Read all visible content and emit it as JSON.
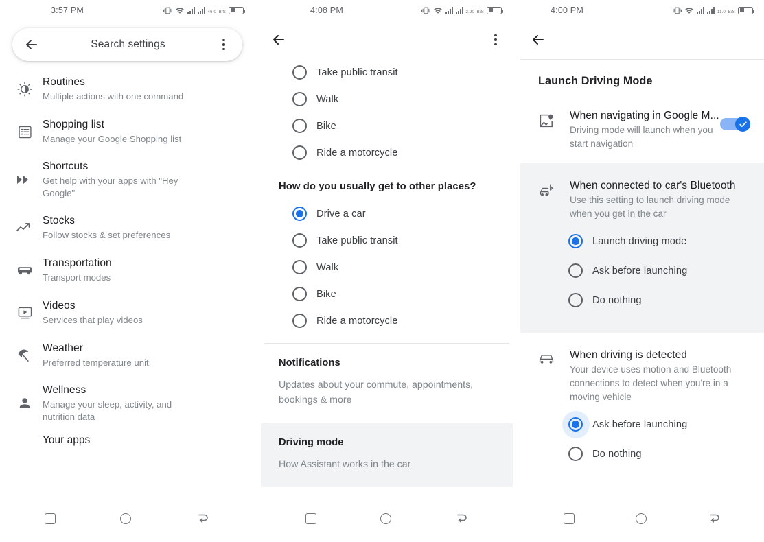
{
  "panels": {
    "left": {
      "status": {
        "time": "3:57 PM",
        "net_speed": "46.0",
        "net_unit": "B/S"
      },
      "search": {
        "placeholder": "Search settings",
        "back_icon": "arrow-back-icon",
        "more_icon": "more-vert-icon"
      },
      "items": [
        {
          "icon": "routines-icon",
          "title": "Routines",
          "subtitle": "Multiple actions with one command"
        },
        {
          "icon": "shopping-list-icon",
          "title": "Shopping list",
          "subtitle": "Manage your Google Shopping list"
        },
        {
          "icon": "shortcuts-icon",
          "title": "Shortcuts",
          "subtitle": "Get help with your apps with \"Hey Google\""
        },
        {
          "icon": "stocks-icon",
          "title": "Stocks",
          "subtitle": "Follow stocks & set preferences"
        },
        {
          "icon": "transportation-icon",
          "title": "Transportation",
          "subtitle": "Transport modes"
        },
        {
          "icon": "videos-icon",
          "title": "Videos",
          "subtitle": "Services that play videos"
        },
        {
          "icon": "weather-icon",
          "title": "Weather",
          "subtitle": "Preferred temperature unit"
        },
        {
          "icon": "wellness-icon",
          "title": "Wellness",
          "subtitle": "Manage your sleep, activity, and nutrition data"
        }
      ],
      "your_apps": "Your apps"
    },
    "middle": {
      "status": {
        "time": "4:08 PM",
        "net_speed": "2.90",
        "net_unit": "B/S"
      },
      "appbar": {
        "back_icon": "arrow-back-icon",
        "more_icon": "more-vert-icon"
      },
      "top_options": [
        {
          "label": "Take public transit",
          "selected": false
        },
        {
          "label": "Walk",
          "selected": false
        },
        {
          "label": "Bike",
          "selected": false
        },
        {
          "label": "Ride a motorcycle",
          "selected": false
        }
      ],
      "question": "How do you usually get to other places?",
      "other_options": [
        {
          "label": "Drive a car",
          "selected": true
        },
        {
          "label": "Take public transit",
          "selected": false
        },
        {
          "label": "Walk",
          "selected": false
        },
        {
          "label": "Bike",
          "selected": false
        },
        {
          "label": "Ride a motorcycle",
          "selected": false
        }
      ],
      "notifications": {
        "title": "Notifications",
        "subtitle": "Updates about your commute, appointments, bookings & more"
      },
      "driving_mode": {
        "title": "Driving mode",
        "subtitle": "How Assistant works in the car"
      }
    },
    "right": {
      "status": {
        "time": "4:00 PM",
        "net_speed": "11.0",
        "net_unit": "B/S"
      },
      "appbar": {
        "back_icon": "arrow-back-icon"
      },
      "title": "Launch Driving Mode",
      "items": [
        {
          "icon": "map-pin-icon",
          "head": "When navigating in Google M...",
          "sub": "Driving mode will launch when you start navigation",
          "toggle": {
            "name": "navigation-toggle",
            "on": true
          },
          "options": []
        },
        {
          "icon": "car-bluetooth-icon",
          "head": "When connected to car's Bluetooth",
          "sub": "Use this setting to launch driving mode when you get in the car",
          "toggle": null,
          "options": [
            {
              "label": "Launch driving mode",
              "selected": true
            },
            {
              "label": "Ask before launching",
              "selected": false
            },
            {
              "label": "Do nothing",
              "selected": false
            }
          ]
        },
        {
          "icon": "car-icon",
          "head": "When driving is detected",
          "sub": "Your device uses motion and Bluetooth connections to detect when you're in a moving vehicle",
          "toggle": null,
          "options": [
            {
              "label": "Ask before launching",
              "selected": true,
              "halo": true
            },
            {
              "label": "Do nothing",
              "selected": false
            }
          ]
        }
      ]
    }
  },
  "navbar": {
    "recents": "square-nav-icon",
    "home": "circle-nav-icon",
    "back": "back-nav-icon"
  },
  "colors": {
    "accent": "#1a73e8",
    "toggle_track": "#8ab4f8",
    "highlight_bg": "#f1f3f4",
    "text_primary": "#202124",
    "text_secondary": "#80868b"
  }
}
